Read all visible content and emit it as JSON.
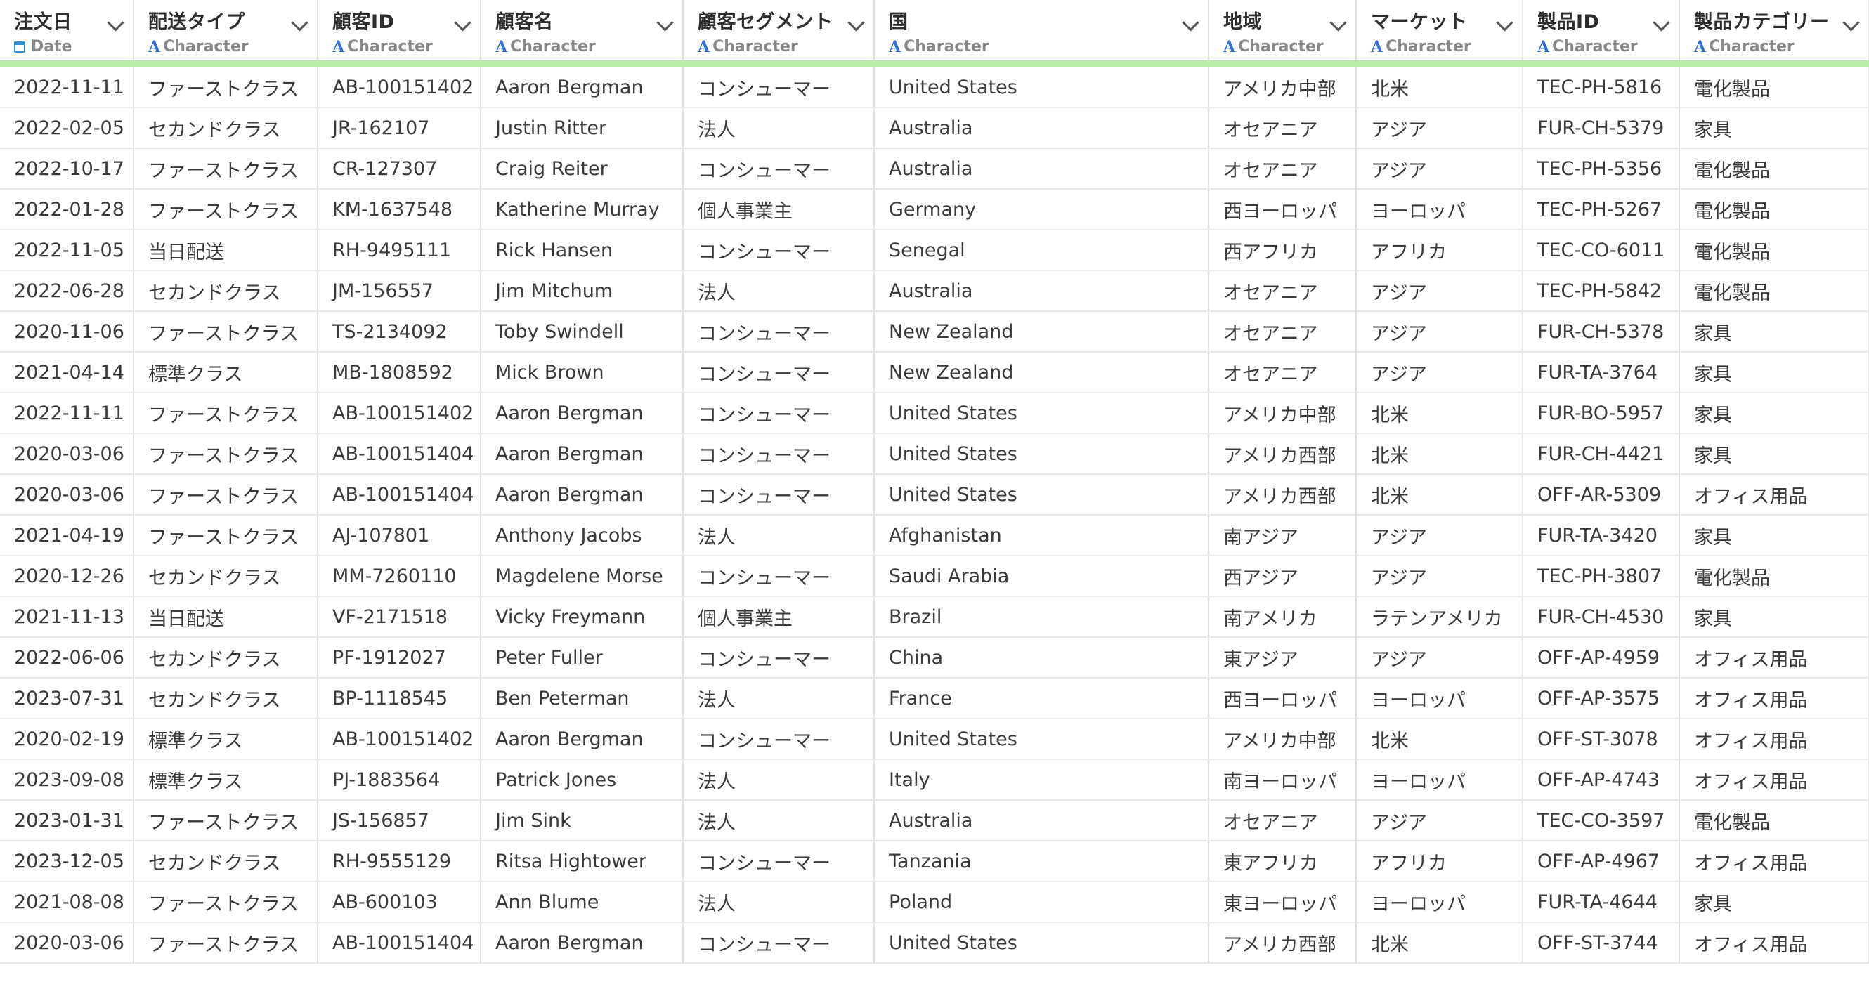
{
  "columns": [
    {
      "name": "注文日",
      "type": "Date",
      "icon": "calendar-icon"
    },
    {
      "name": "配送タイプ",
      "type": "Character",
      "icon": "character-type-icon"
    },
    {
      "name": "顧客ID",
      "type": "Character",
      "icon": "character-type-icon"
    },
    {
      "name": "顧客名",
      "type": "Character",
      "icon": "character-type-icon"
    },
    {
      "name": "顧客セグメント",
      "type": "Character",
      "icon": "character-type-icon"
    },
    {
      "name": "国",
      "type": "Character",
      "icon": "character-type-icon"
    },
    {
      "name": "地域",
      "type": "Character",
      "icon": "character-type-icon"
    },
    {
      "name": "マーケット",
      "type": "Character",
      "icon": "character-type-icon"
    },
    {
      "name": "製品ID",
      "type": "Character",
      "icon": "character-type-icon"
    },
    {
      "name": "製品カテゴリー",
      "type": "Character",
      "icon": "character-type-icon"
    }
  ],
  "type_icon_glyph": "A",
  "rows": [
    [
      "2022-11-11",
      "ファーストクラス",
      "AB-100151402",
      "Aaron Bergman",
      "コンシューマー",
      "United States",
      "アメリカ中部",
      "北米",
      "TEC-PH-5816",
      "電化製品"
    ],
    [
      "2022-02-05",
      "セカンドクラス",
      "JR-162107",
      "Justin Ritter",
      "法人",
      "Australia",
      "オセアニア",
      "アジア",
      "FUR-CH-5379",
      "家具"
    ],
    [
      "2022-10-17",
      "ファーストクラス",
      "CR-127307",
      "Craig Reiter",
      "コンシューマー",
      "Australia",
      "オセアニア",
      "アジア",
      "TEC-PH-5356",
      "電化製品"
    ],
    [
      "2022-01-28",
      "ファーストクラス",
      "KM-1637548",
      "Katherine Murray",
      "個人事業主",
      "Germany",
      "西ヨーロッパ",
      "ヨーロッパ",
      "TEC-PH-5267",
      "電化製品"
    ],
    [
      "2022-11-05",
      "当日配送",
      "RH-9495111",
      "Rick Hansen",
      "コンシューマー",
      "Senegal",
      "西アフリカ",
      "アフリカ",
      "TEC-CO-6011",
      "電化製品"
    ],
    [
      "2022-06-28",
      "セカンドクラス",
      "JM-156557",
      "Jim Mitchum",
      "法人",
      "Australia",
      "オセアニア",
      "アジア",
      "TEC-PH-5842",
      "電化製品"
    ],
    [
      "2020-11-06",
      "ファーストクラス",
      "TS-2134092",
      "Toby Swindell",
      "コンシューマー",
      "New Zealand",
      "オセアニア",
      "アジア",
      "FUR-CH-5378",
      "家具"
    ],
    [
      "2021-04-14",
      "標準クラス",
      "MB-1808592",
      "Mick Brown",
      "コンシューマー",
      "New Zealand",
      "オセアニア",
      "アジア",
      "FUR-TA-3764",
      "家具"
    ],
    [
      "2022-11-11",
      "ファーストクラス",
      "AB-100151402",
      "Aaron Bergman",
      "コンシューマー",
      "United States",
      "アメリカ中部",
      "北米",
      "FUR-BO-5957",
      "家具"
    ],
    [
      "2020-03-06",
      "ファーストクラス",
      "AB-100151404",
      "Aaron Bergman",
      "コンシューマー",
      "United States",
      "アメリカ西部",
      "北米",
      "FUR-CH-4421",
      "家具"
    ],
    [
      "2020-03-06",
      "ファーストクラス",
      "AB-100151404",
      "Aaron Bergman",
      "コンシューマー",
      "United States",
      "アメリカ西部",
      "北米",
      "OFF-AR-5309",
      "オフィス用品"
    ],
    [
      "2021-04-19",
      "ファーストクラス",
      "AJ-107801",
      "Anthony Jacobs",
      "法人",
      "Afghanistan",
      "南アジア",
      "アジア",
      "FUR-TA-3420",
      "家具"
    ],
    [
      "2020-12-26",
      "セカンドクラス",
      "MM-7260110",
      "Magdelene Morse",
      "コンシューマー",
      "Saudi Arabia",
      "西アジア",
      "アジア",
      "TEC-PH-3807",
      "電化製品"
    ],
    [
      "2021-11-13",
      "当日配送",
      "VF-2171518",
      "Vicky Freymann",
      "個人事業主",
      "Brazil",
      "南アメリカ",
      "ラテンアメリカ",
      "FUR-CH-4530",
      "家具"
    ],
    [
      "2022-06-06",
      "セカンドクラス",
      "PF-1912027",
      "Peter Fuller",
      "コンシューマー",
      "China",
      "東アジア",
      "アジア",
      "OFF-AP-4959",
      "オフィス用品"
    ],
    [
      "2023-07-31",
      "セカンドクラス",
      "BP-1118545",
      "Ben Peterman",
      "法人",
      "France",
      "西ヨーロッパ",
      "ヨーロッパ",
      "OFF-AP-3575",
      "オフィス用品"
    ],
    [
      "2020-02-19",
      "標準クラス",
      "AB-100151402",
      "Aaron Bergman",
      "コンシューマー",
      "United States",
      "アメリカ中部",
      "北米",
      "OFF-ST-3078",
      "オフィス用品"
    ],
    [
      "2023-09-08",
      "標準クラス",
      "PJ-1883564",
      "Patrick Jones",
      "法人",
      "Italy",
      "南ヨーロッパ",
      "ヨーロッパ",
      "OFF-AP-4743",
      "オフィス用品"
    ],
    [
      "2023-01-31",
      "ファーストクラス",
      "JS-156857",
      "Jim Sink",
      "法人",
      "Australia",
      "オセアニア",
      "アジア",
      "TEC-CO-3597",
      "電化製品"
    ],
    [
      "2023-12-05",
      "セカンドクラス",
      "RH-9555129",
      "Ritsa Hightower",
      "コンシューマー",
      "Tanzania",
      "東アフリカ",
      "アフリカ",
      "OFF-AP-4967",
      "オフィス用品"
    ],
    [
      "2021-08-08",
      "ファーストクラス",
      "AB-600103",
      "Ann Blume",
      "法人",
      "Poland",
      "東ヨーロッパ",
      "ヨーロッパ",
      "FUR-TA-4644",
      "家具"
    ],
    [
      "2020-03-06",
      "ファーストクラス",
      "AB-100151404",
      "Aaron Bergman",
      "コンシューマー",
      "United States",
      "アメリカ西部",
      "北米",
      "OFF-ST-3744",
      "オフィス用品"
    ]
  ]
}
